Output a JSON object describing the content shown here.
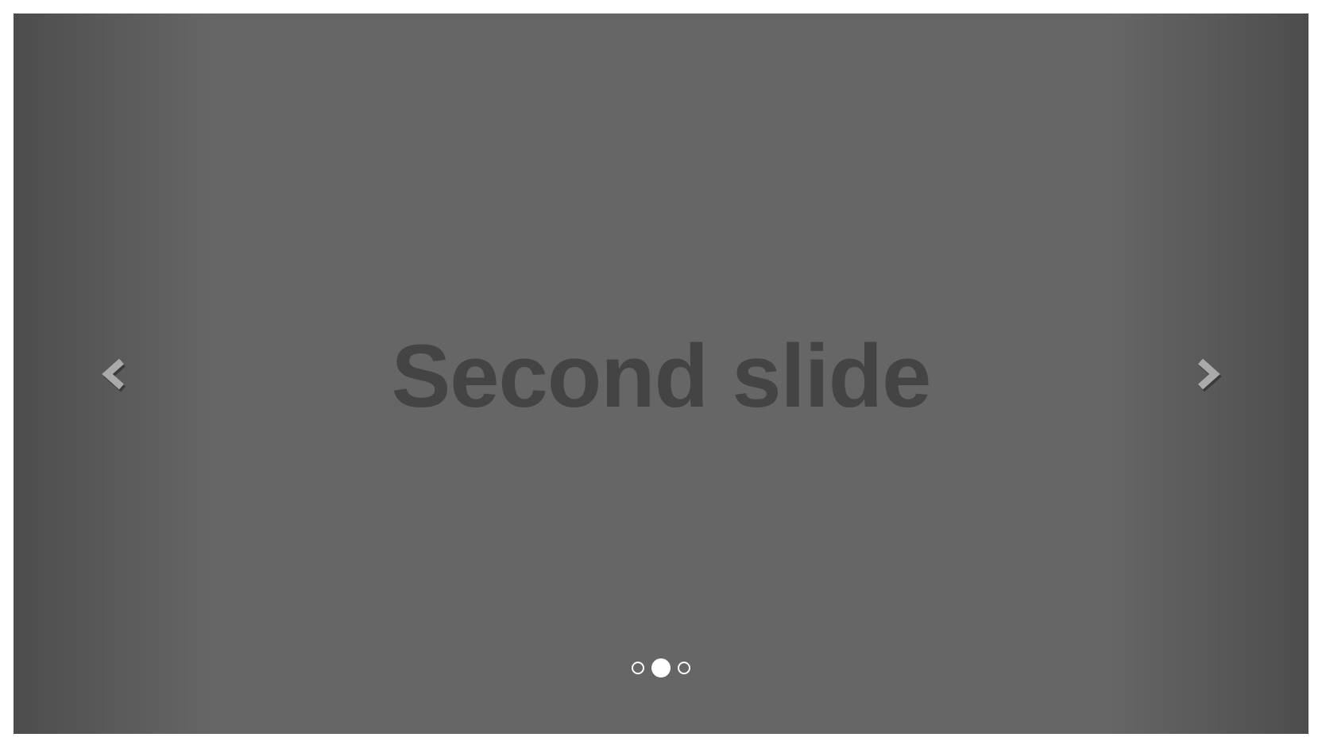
{
  "carousel": {
    "slides": [
      {
        "heading": "Second slide"
      }
    ],
    "active_index": 1,
    "indicator_count": 3,
    "controls": {
      "prev_icon": "chevron-left-icon",
      "next_icon": "chevron-right-icon"
    },
    "colors": {
      "background": "#666666",
      "heading": "#444444",
      "control_glyph": "#aaaaaa",
      "indicator": "#ffffff"
    }
  }
}
